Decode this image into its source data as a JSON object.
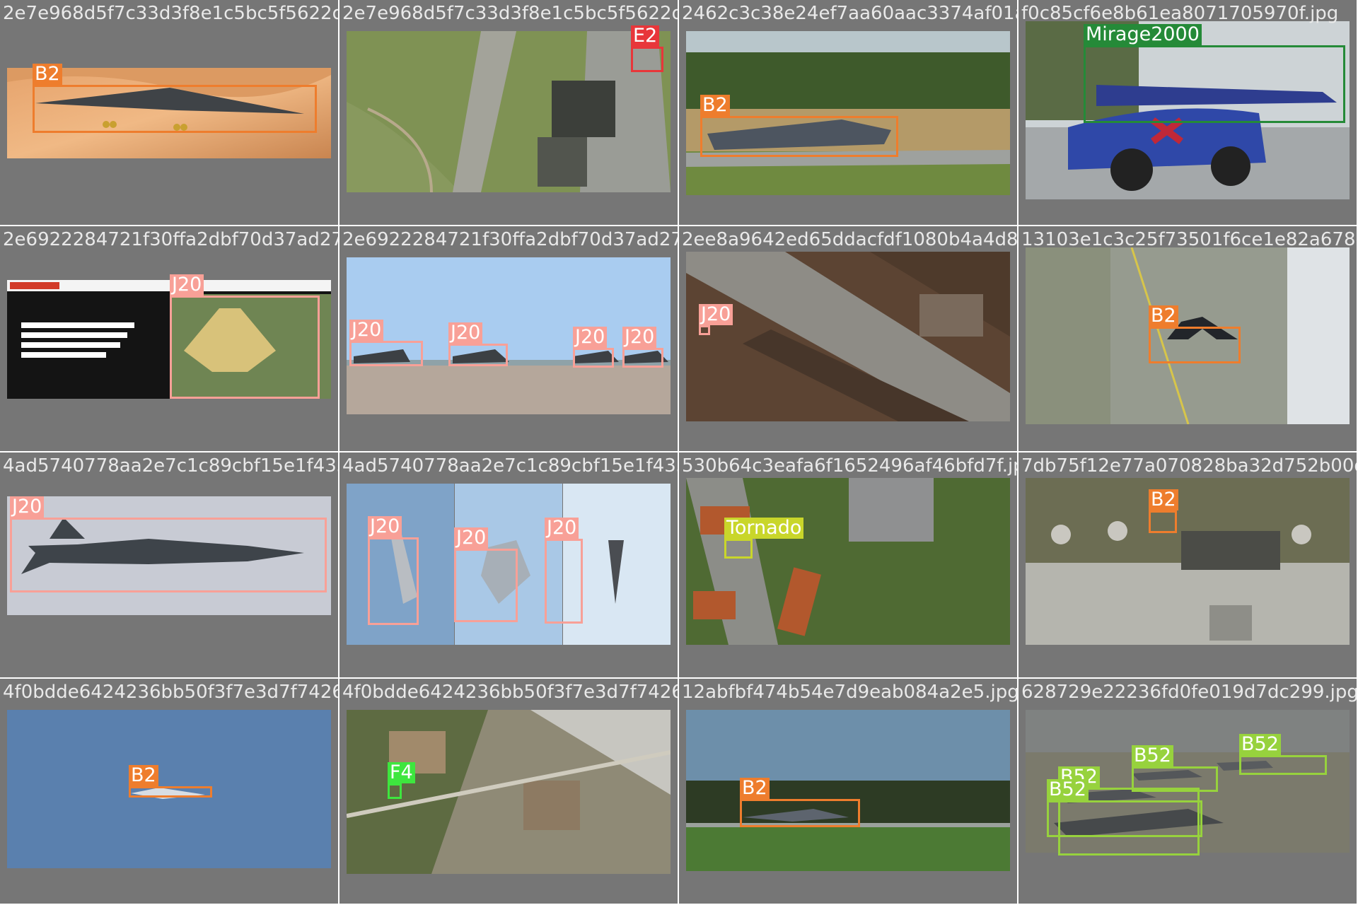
{
  "colors": {
    "B2": "#ee7d2d",
    "E2": "#e8363a",
    "Mirage2000": "#258a38",
    "J20": "#f8a097",
    "Tornado": "#c9d62a",
    "F4": "#3ee63e",
    "B52": "#97d23d",
    "tile_bg": "#767676"
  },
  "tiles": [
    {
      "filename": "2e7e968d5f7c33d3f8e1c5bc5f5622d4c9.jpg",
      "boxes": [
        {
          "label": "B2"
        }
      ]
    },
    {
      "filename": "2e7e968d5f7c33d3f8e1c5bc5f5622d4c9.jpg",
      "boxes": [
        {
          "label": "E2"
        }
      ]
    },
    {
      "filename": "2462c3c38e24ef7aa60aac3374af01a.jpg",
      "boxes": [
        {
          "label": "B2"
        }
      ]
    },
    {
      "filename": "f0c85cf6e8b61ea8071705970f.jpg",
      "boxes": [
        {
          "label": "Mirage2000"
        }
      ]
    },
    {
      "filename": "2e6922284721f30ffa2dbf70d37ad27d92.jpg",
      "boxes": [
        {
          "label": "J20"
        }
      ]
    },
    {
      "filename": "2e6922284721f30ffa2dbf70d37ad27d92.jpg",
      "boxes": [
        {
          "label": "J20"
        },
        {
          "label": "J20"
        },
        {
          "label": "J20"
        },
        {
          "label": "J20"
        }
      ]
    },
    {
      "filename": "2ee8a9642ed65ddacfdf1080b4a4d8c363d.jpg",
      "boxes": [
        {
          "label": "J20"
        }
      ]
    },
    {
      "filename": "13103e1c3c25f73501f6ce1e82a678dc995e3d5e5.jpg",
      "boxes": [
        {
          "label": "B2"
        }
      ]
    },
    {
      "filename": "4ad5740778aa2e7c1c89cbf15e1f433a.jpg",
      "boxes": [
        {
          "label": "J20"
        }
      ]
    },
    {
      "filename": "4ad5740778aa2e7c1c89cbf15e1f433a.jpg",
      "boxes": [
        {
          "label": "J20"
        },
        {
          "label": "J20"
        },
        {
          "label": "J20"
        }
      ]
    },
    {
      "filename": "530b64c3eafa6f1652496af46bfd7f.jpg",
      "boxes": [
        {
          "label": "Tornado"
        }
      ]
    },
    {
      "filename": "7db75f12e77a070828ba32d752b00dcf43742918ee7270d7f.jpg",
      "boxes": [
        {
          "label": "B2"
        }
      ]
    },
    {
      "filename": "4f0bdde6424236bb50f3f7e3d7f7426f.jpg",
      "boxes": [
        {
          "label": "B2"
        }
      ]
    },
    {
      "filename": "4f0bdde6424236bb50f3f7e3d7f7426f.jpg",
      "boxes": [
        {
          "label": "F4"
        }
      ]
    },
    {
      "filename": "12abfbf474b54e7d9eab084a2e5.jpg",
      "boxes": [
        {
          "label": "B2"
        }
      ]
    },
    {
      "filename": "628729e22236fd0fe019d7dc299.jpg",
      "boxes": [
        {
          "label": "B52"
        },
        {
          "label": "B52"
        },
        {
          "label": "B52"
        },
        {
          "label": "B52"
        }
      ]
    }
  ]
}
